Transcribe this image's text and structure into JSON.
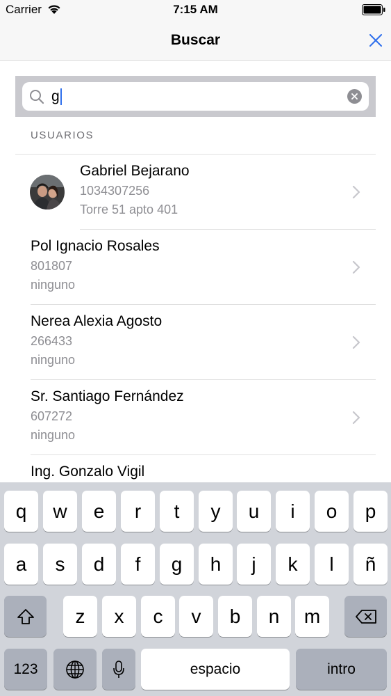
{
  "status_bar": {
    "carrier": "Carrier",
    "time": "7:15 AM"
  },
  "nav": {
    "title": "Buscar",
    "close_icon": "close-icon"
  },
  "search": {
    "value": "g"
  },
  "section": {
    "header": "USUARIOS"
  },
  "users": [
    {
      "name": "Gabriel Bejarano",
      "phone": "1034307256",
      "address": "Torre 51 apto 401",
      "has_avatar": true
    },
    {
      "name": "Pol Ignacio Rosales",
      "phone": "801807",
      "address": "ninguno",
      "has_avatar": false
    },
    {
      "name": "Nerea Alexia Agosto",
      "phone": "266433",
      "address": "ninguno",
      "has_avatar": false
    },
    {
      "name": "Sr. Santiago Fernández",
      "phone": "607272",
      "address": "ninguno",
      "has_avatar": false
    },
    {
      "name": "Ing. Gonzalo Vigil",
      "phone": "",
      "address": "",
      "has_avatar": false
    }
  ],
  "keyboard": {
    "row1": [
      "q",
      "w",
      "e",
      "r",
      "t",
      "y",
      "u",
      "i",
      "o",
      "p"
    ],
    "row2": [
      "a",
      "s",
      "d",
      "f",
      "g",
      "h",
      "j",
      "k",
      "l",
      "ñ"
    ],
    "row3": [
      "z",
      "x",
      "c",
      "v",
      "b",
      "n",
      "m"
    ],
    "numbers_label": "123",
    "space_label": "espacio",
    "return_label": "intro"
  },
  "colors": {
    "accent": "#2f6fec",
    "secondary_text": "#8e8e93",
    "keyboard_bg": "#d1d4da"
  }
}
